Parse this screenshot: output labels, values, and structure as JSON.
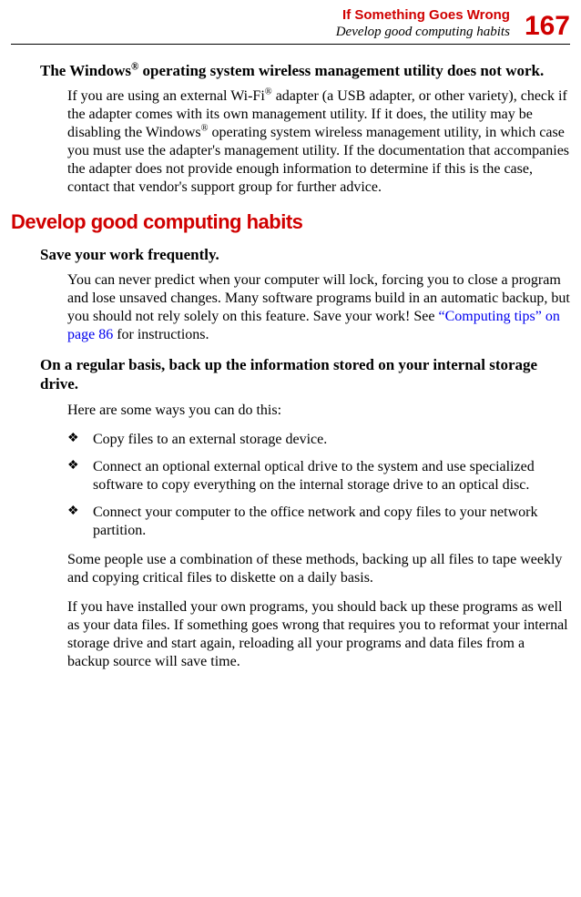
{
  "header": {
    "title": "If Something Goes Wrong",
    "subtitle": "Develop good computing habits",
    "pageNumber": "167"
  },
  "section1": {
    "heading_pre": "The Windows",
    "heading_sup": "®",
    "heading_post": " operating system wireless management utility does not work.",
    "body_p1_pre": "If you are using an external Wi-Fi",
    "body_p1_sup1": "®",
    "body_p1_mid": " adapter (a USB adapter, or other variety), check if the adapter comes with its own management utility. If it does, the utility may be disabling the Windows",
    "body_p1_sup2": "®",
    "body_p1_post": " operating system wireless management utility, in which case you must use the adapter's management utility. If the documentation that accompanies the adapter does not provide enough information to determine if this is the case, contact that vendor's support group for further advice."
  },
  "section2": {
    "heading": "Develop good computing habits",
    "sub1_heading": "Save your work frequently.",
    "sub1_body_pre": "You can never predict when your computer will lock, forcing you to close a program and lose unsaved changes. Many software programs build in an automatic backup, but you should not rely solely on this feature. Save your work! See ",
    "sub1_body_link": "“Computing tips” on page 86",
    "sub1_body_post": " for instructions.",
    "sub2_heading": "On a regular basis, back up the information stored on your internal storage drive.",
    "sub2_intro": "Here are some ways you can do this:",
    "bullets": [
      "Copy files to an external storage device.",
      "Connect an optional external optical drive to the system and use specialized software to copy everything on the internal storage drive to an optical disc.",
      "Connect your computer to the office network and copy files to your network partition."
    ],
    "sub2_p2": "Some people use a combination of these methods, backing up all files to tape weekly and copying critical files to diskette on a daily basis.",
    "sub2_p3": "If you have installed your own programs, you should back up these programs as well as your data files. If something goes wrong that requires you to reformat your internal storage drive and start again, reloading all your programs and data files from a backup source will save time."
  },
  "glyphs": {
    "bullet": "❖"
  }
}
